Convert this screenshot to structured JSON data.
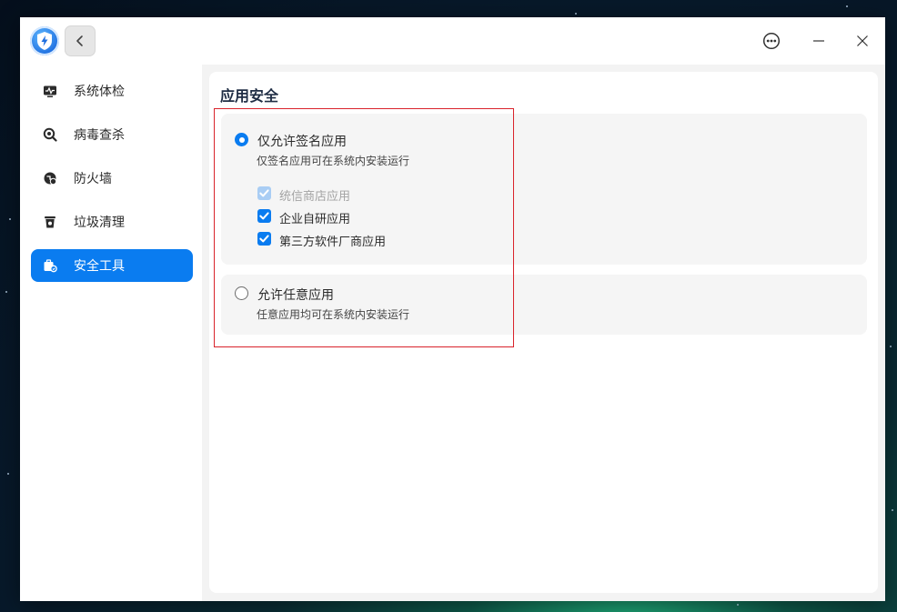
{
  "window": {
    "logo_icon": "shield-lightning-icon",
    "back_icon": "chevron-left-icon",
    "menu_icon": "more-circle-icon",
    "minimize_icon": "minimize-icon",
    "close_icon": "close-icon"
  },
  "sidebar": {
    "items": [
      {
        "label": "系统体检",
        "icon": "pulse-monitor-icon",
        "active": false
      },
      {
        "label": "病毒查杀",
        "icon": "virus-scan-icon",
        "active": false
      },
      {
        "label": "防火墙",
        "icon": "firewall-icon",
        "active": false
      },
      {
        "label": "垃圾清理",
        "icon": "trash-can-icon",
        "active": false
      },
      {
        "label": "安全工具",
        "icon": "toolbox-icon",
        "active": true
      }
    ]
  },
  "main": {
    "title": "应用安全",
    "options": [
      {
        "title": "仅允许签名应用",
        "description": "仅签名应用可在系统内安装运行",
        "selected": true,
        "sub_options": [
          {
            "label": "统信商店应用",
            "checked": true,
            "disabled": true
          },
          {
            "label": "企业自研应用",
            "checked": true,
            "disabled": false
          },
          {
            "label": "第三方软件厂商应用",
            "checked": true,
            "disabled": false
          }
        ]
      },
      {
        "title": "允许任意应用",
        "description": "任意应用均可在系统内安装运行",
        "selected": false
      }
    ]
  },
  "colors": {
    "accent": "#0a7cf0",
    "highlight_border": "#d9232b",
    "disabled_check": "#a9cdf4"
  }
}
